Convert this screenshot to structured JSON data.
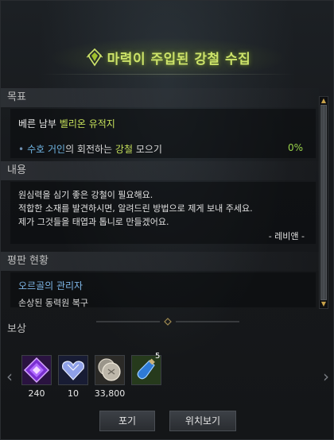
{
  "window": {
    "title": "마력이 주입된 강철 수집",
    "accent_color": "#cde36a"
  },
  "objective": {
    "header": "목표",
    "main_prefix": "베른 남부 ",
    "main_highlight": "벨리온 유적지",
    "sub_bullet": "•",
    "sub_blue": "수호 거인",
    "sub_mid": "의 회전하는 ",
    "sub_highlight": "강철",
    "sub_suffix": " 모으기",
    "progress": "0%"
  },
  "content": {
    "header": "내용",
    "lines": [
      "원심력을 심기 좋은 강철이 필요해요.",
      "적합한 소재를 발견하시면, 알려드린 방법으로 제게 보내 주세요.",
      "제가 그것들을 태엽과 톱니로 만들겠어요."
    ],
    "signature": "- 레비앤 -"
  },
  "reputation": {
    "header": "평판 현황",
    "title": "오르골의 관리자",
    "subtitle": "손상된 동력원 복구"
  },
  "rewards": {
    "header": "보상",
    "items": [
      {
        "icon": "purple-crystal-icon",
        "qty": "240"
      },
      {
        "icon": "diamond-heart-icon",
        "qty": "10"
      },
      {
        "icon": "silver-coins-icon",
        "qty": "33,800"
      },
      {
        "icon": "blue-potion-icon",
        "qty": "",
        "stack": "5"
      }
    ]
  },
  "buttons": {
    "abandon": "포기",
    "locate": "위치보기"
  }
}
